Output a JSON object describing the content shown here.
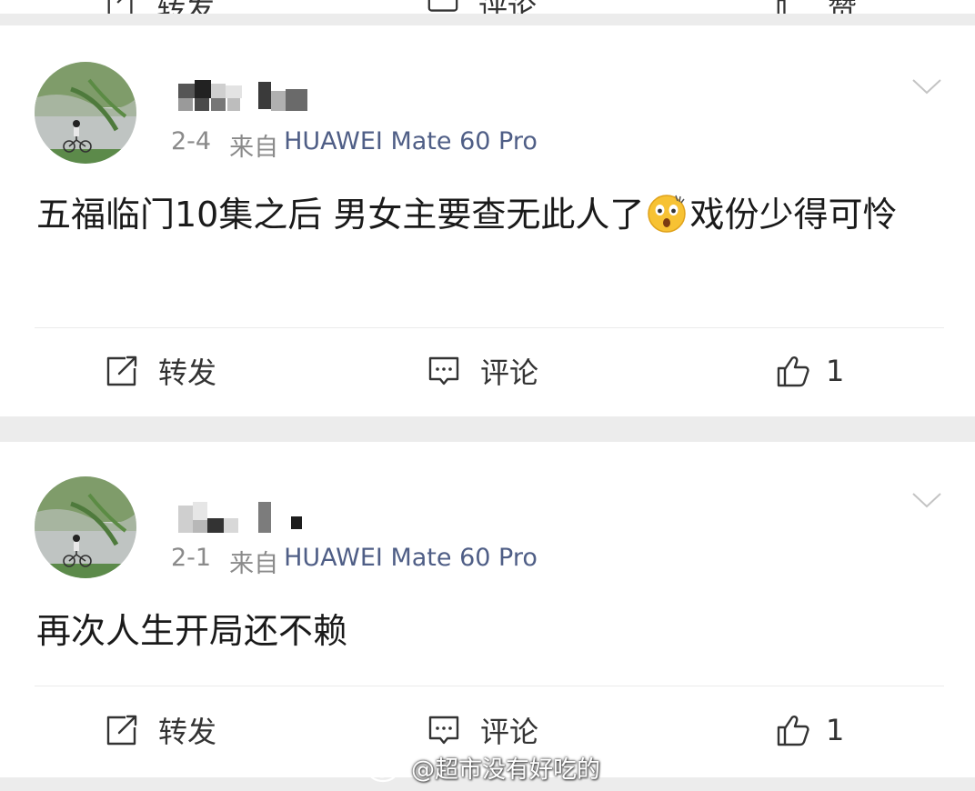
{
  "top_action_bar": {
    "repost_label": "转发",
    "comment_label": "评论",
    "like_label": "赞"
  },
  "posts": [
    {
      "date": "2-4",
      "from_label": "来自",
      "device": "HUAWEI Mate 60 Pro",
      "content_before_emoji": "五福临门10集之后 男女主要查无此人了",
      "emoji": "shocked-face-emoji",
      "content_after_emoji": "戏份少得可怜",
      "repost_label": "转发",
      "comment_label": "评论",
      "like_count": "1"
    },
    {
      "date": "2-1",
      "from_label": "来自",
      "device": "HUAWEI Mate 60 Pro",
      "content": "再次人生开局还不赖",
      "repost_label": "转发",
      "comment_label": "评论",
      "like_count": "1"
    }
  ],
  "watermark": {
    "text": "@超市没有好吃的",
    "icon": "weibo-logo"
  },
  "colors": {
    "background": "#ececec",
    "card": "#ffffff",
    "device_link": "#4f5e86",
    "meta_gray": "#8a8a8a",
    "text": "#1a1a1a"
  }
}
